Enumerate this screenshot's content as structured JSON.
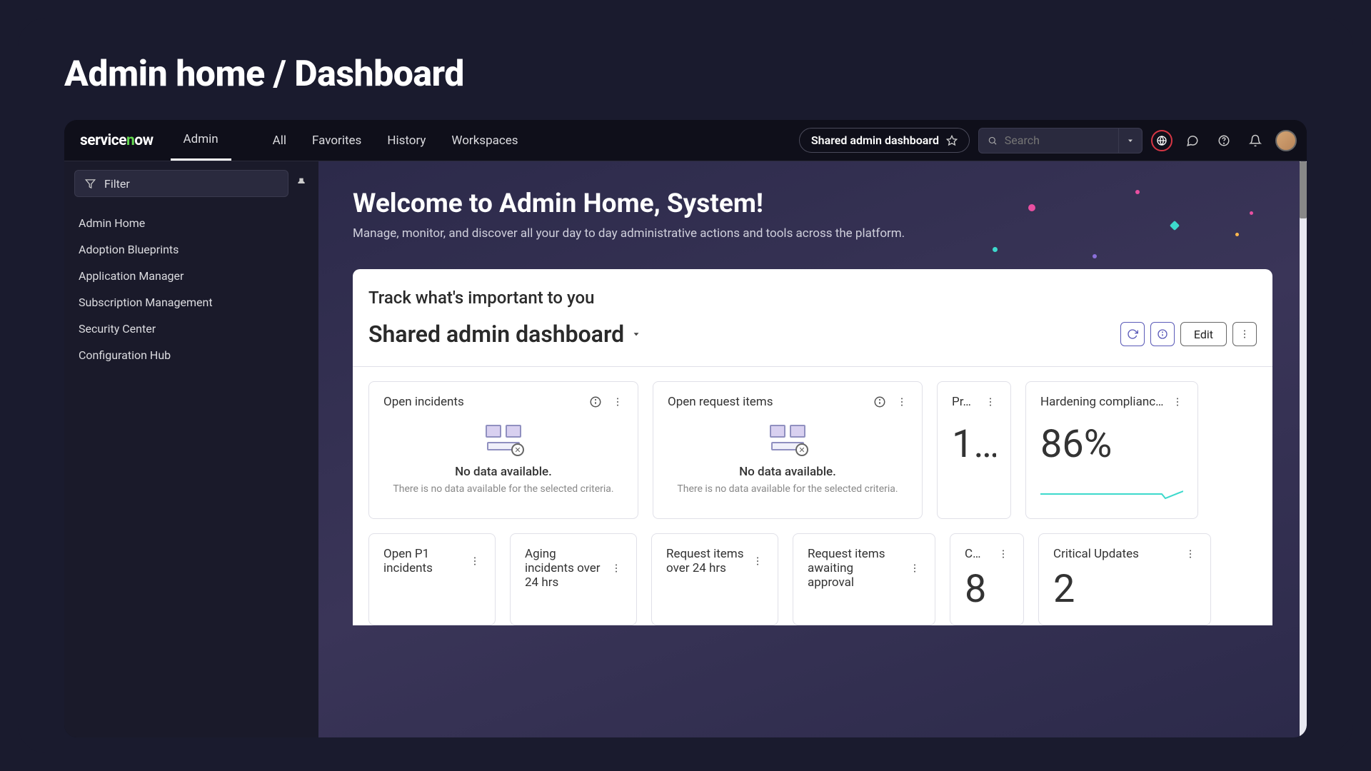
{
  "page_heading": "Admin home / Dashboard",
  "brand": "servicenow",
  "topbar": {
    "admin_tab": "Admin",
    "nav": [
      "All",
      "Favorites",
      "History",
      "Workspaces"
    ],
    "dashboard_pill": "Shared admin dashboard",
    "search_placeholder": "Search"
  },
  "sidebar": {
    "filter_placeholder": "Filter",
    "items": [
      "Admin Home",
      "Adoption Blueprints",
      "Application Manager",
      "Subscription Management",
      "Security Center",
      "Configuration Hub"
    ]
  },
  "welcome": {
    "title": "Welcome to Admin Home, System!",
    "subtitle": "Manage, monitor, and discover all your day to day administrative actions and tools across the platform."
  },
  "dashboard": {
    "track_heading": "Track what's important to you",
    "title": "Shared admin dashboard",
    "edit_label": "Edit",
    "no_data_title": "No data available.",
    "no_data_sub": "There is no data available for the selected criteria.",
    "row1": [
      {
        "title": "Open incidents",
        "type": "nodata"
      },
      {
        "title": "Open request items",
        "type": "nodata"
      },
      {
        "title": "Pr…",
        "value": "1…"
      },
      {
        "title": "Hardening complianc…",
        "value": "86%"
      }
    ],
    "row2": [
      {
        "title": "Open P1 incidents"
      },
      {
        "title": "Aging incidents over 24 hrs"
      },
      {
        "title": "Request items over 24 hrs"
      },
      {
        "title": "Request items awaiting approval"
      },
      {
        "title": "C…",
        "value": "8"
      },
      {
        "title": "Critical Updates",
        "value": "2"
      }
    ]
  }
}
